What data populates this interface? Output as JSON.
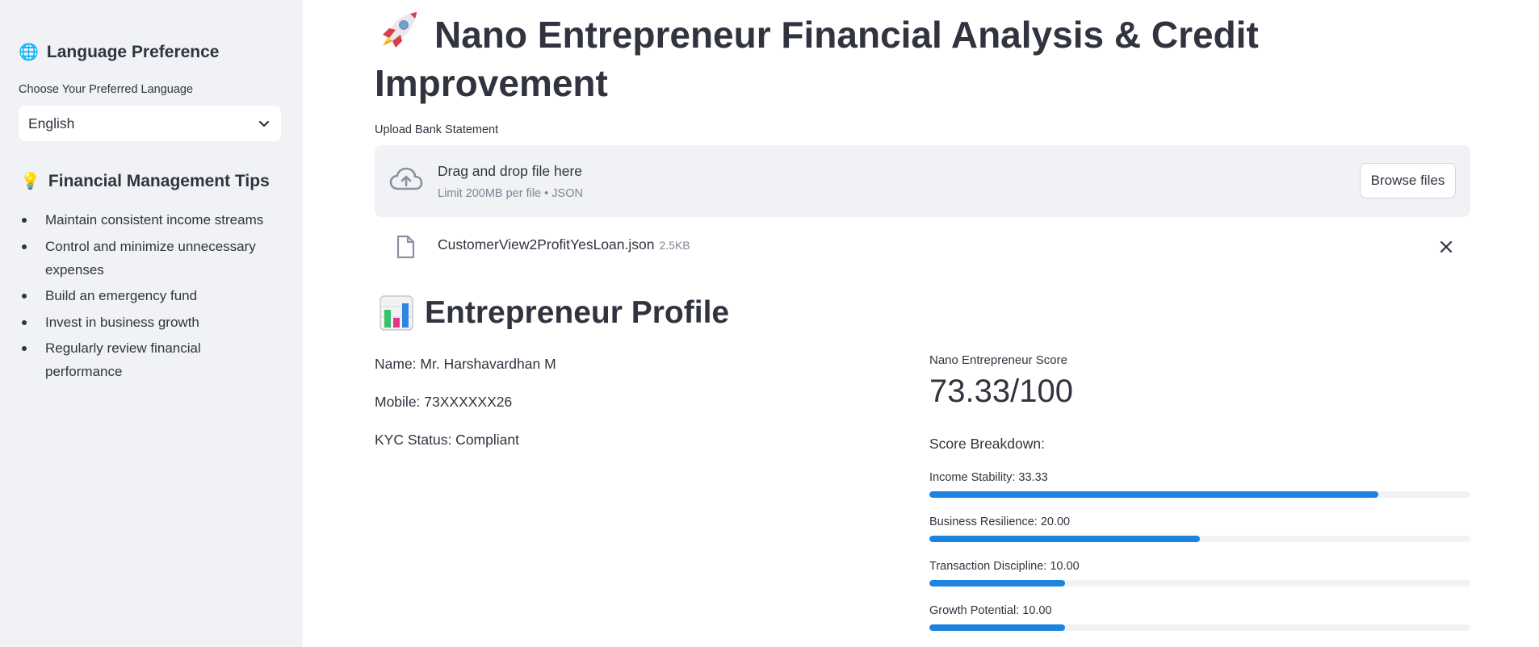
{
  "sidebar": {
    "language_heading": {
      "icon": "globe-icon",
      "emoji": "🌐",
      "text": "Language Preference"
    },
    "language_select": {
      "label": "Choose Your Preferred Language",
      "value": "English",
      "icon": "chevron-down-icon"
    },
    "tips_heading": {
      "icon": "lightbulb-icon",
      "emoji": "💡",
      "text": "Financial Management Tips"
    },
    "tips": [
      "Maintain consistent income streams",
      "Control and minimize unnecessary expenses",
      "Build an emergency fund",
      "Invest in business growth",
      "Regularly review financial performance"
    ]
  },
  "main": {
    "title": {
      "icon": "rocket-icon",
      "text": "Nano Entrepreneur Financial Analysis & Credit Improvement"
    },
    "upload": {
      "label": "Upload Bank Statement",
      "drop_title": "Drag and drop file here",
      "drop_subtitle": "Limit 200MB per file • JSON",
      "browse_label": "Browse files",
      "icon": "cloud-upload-icon"
    },
    "uploaded_file": {
      "icon": "file-icon",
      "name": "CustomerView2ProfitYesLoan.json",
      "size": "2.5KB",
      "remove_icon": "close-icon"
    },
    "profile": {
      "heading": {
        "icon": "bar-chart-icon",
        "text": "Entrepreneur Profile"
      },
      "name_line": "Name: Mr. Harshavardhan M",
      "mobile_line": "Mobile: 73XXXXXX26",
      "kyc_line": "KYC Status: Compliant"
    },
    "score": {
      "label": "Nano Entrepreneur Score",
      "value": "73.33/100",
      "breakdown_title": "Score Breakdown:",
      "items": [
        {
          "label": "Income Stability: 33.33",
          "progress": 0.83
        },
        {
          "label": "Business Resilience: 20.00",
          "progress": 0.5
        },
        {
          "label": "Transaction Discipline: 10.00",
          "progress": 0.25
        },
        {
          "label": "Growth Potential: 10.00",
          "progress": 0.25
        }
      ],
      "bar_color": "#1c83e1"
    }
  },
  "colors": {
    "sidebar_bg": "#f0f2f6",
    "text": "#31333f",
    "muted_text": "#808495",
    "accent": "#1c83e1"
  }
}
